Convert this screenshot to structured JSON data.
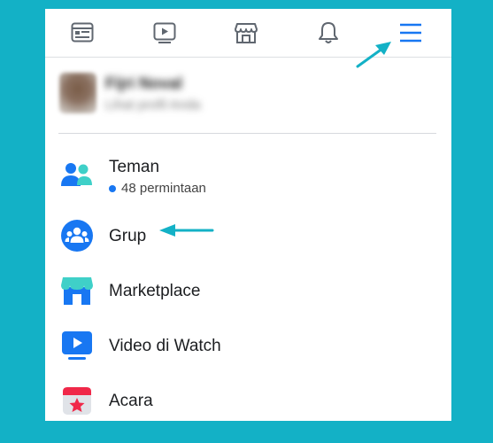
{
  "topbar": {
    "icons": [
      "news-feed-icon",
      "watch-icon",
      "marketplace-icon",
      "notifications-icon",
      "menu-icon"
    ]
  },
  "profile": {
    "name": "Fijri Noval",
    "subtitle": "Lihat profil Anda"
  },
  "menu": {
    "items": [
      {
        "label": "Teman",
        "sub": "48 permintaan",
        "icon": "friends-icon"
      },
      {
        "label": "Grup",
        "icon": "groups-icon"
      },
      {
        "label": "Marketplace",
        "icon": "marketplace-store-icon"
      },
      {
        "label": "Video di Watch",
        "icon": "video-watch-icon"
      },
      {
        "label": "Acara",
        "icon": "events-calendar-icon"
      }
    ]
  },
  "colors": {
    "background": "#13b1c6",
    "accent": "#1877f2",
    "arrow": "#13b1c6"
  }
}
